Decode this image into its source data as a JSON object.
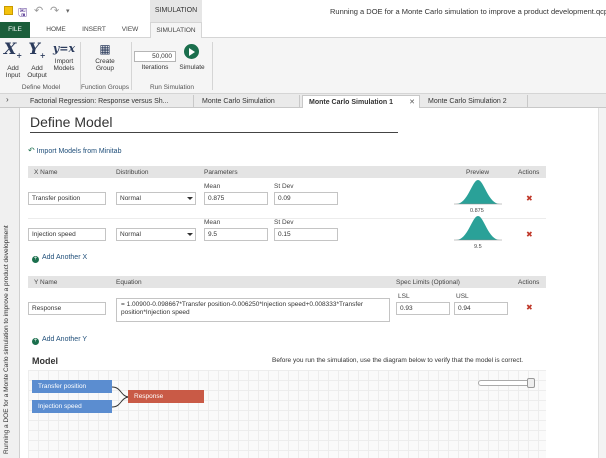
{
  "window": {
    "title": "Running a DOE for a Monte Carlo simulation to improve a product development.qcpx",
    "context_tab": "SIMULATION"
  },
  "ribbon": {
    "tabs": [
      "FILE",
      "HOME",
      "INSERT",
      "VIEW",
      "SIMULATION"
    ],
    "active_tab": "SIMULATION",
    "define_model": {
      "add_input": "Add Input",
      "add_output": "Add Output",
      "import_models": "Import Models",
      "group_label": "Define Model"
    },
    "function_groups": {
      "create_group": "Create Group",
      "group_label": "Function Groups"
    },
    "run_simulation": {
      "iterations_value": "50,000",
      "iterations_label": "Iterations",
      "simulate": "Simulate",
      "group_label": "Run Simulation"
    }
  },
  "doc_tabs": [
    "Factorial Regression: Response versus Sh...",
    "Monte Carlo Simulation",
    "Monte Carlo Simulation 1",
    "Monte Carlo Simulation 2"
  ],
  "active_doc_tab": "Monte Carlo Simulation 1",
  "side_panel_text": "Running a DOE for a Monte Carlo simulation to improve a product development",
  "page": {
    "heading": "Define Model",
    "import_link": "Import Models from Minitab",
    "x_table": {
      "headers": {
        "name": "X Name",
        "distribution": "Distribution",
        "parameters": "Parameters",
        "preview": "Preview",
        "actions": "Actions"
      },
      "rows": [
        {
          "name": "Transfer position",
          "distribution": "Normal",
          "p1_label": "Mean",
          "p1_value": "0.875",
          "p2_label": "St Dev",
          "p2_value": "0.09",
          "preview_label": "0.875"
        },
        {
          "name": "Injection speed",
          "distribution": "Normal",
          "p1_label": "Mean",
          "p1_value": "9.5",
          "p2_label": "St Dev",
          "p2_value": "0.15",
          "preview_label": "9.5"
        }
      ],
      "add_link": "Add Another X"
    },
    "y_table": {
      "headers": {
        "name": "Y Name",
        "equation": "Equation",
        "spec_limits": "Spec Limits (Optional)",
        "actions": "Actions"
      },
      "rows": [
        {
          "name": "Response",
          "equation": "= 1.00900-0.098667*Transfer position-0.006250*Injection speed+0.008333*Transfer position*Injection speed",
          "lsl_label": "LSL",
          "lsl_value": "0.93",
          "usl_label": "USL",
          "usl_value": "0.94"
        }
      ],
      "add_link": "Add Another Y"
    },
    "model": {
      "heading": "Model",
      "note": "Before you run the simulation, use the diagram below to verify that the model is correct.",
      "inputs": [
        "Transfer position",
        "Injection speed"
      ],
      "output": "Response"
    }
  },
  "colors": {
    "file_tab": "#1b5e3b",
    "accent_green": "#1b6f4d",
    "preview_teal": "#2aa198",
    "x_node": "#5b8dd0",
    "y_node": "#c95a46",
    "delete_red": "#c0392b"
  },
  "icons": {
    "save": "save-icon",
    "undo": "undo-icon",
    "redo": "redo-icon",
    "delete": "delete-icon",
    "import": "import-arrow-icon",
    "simulate": "play-icon"
  }
}
